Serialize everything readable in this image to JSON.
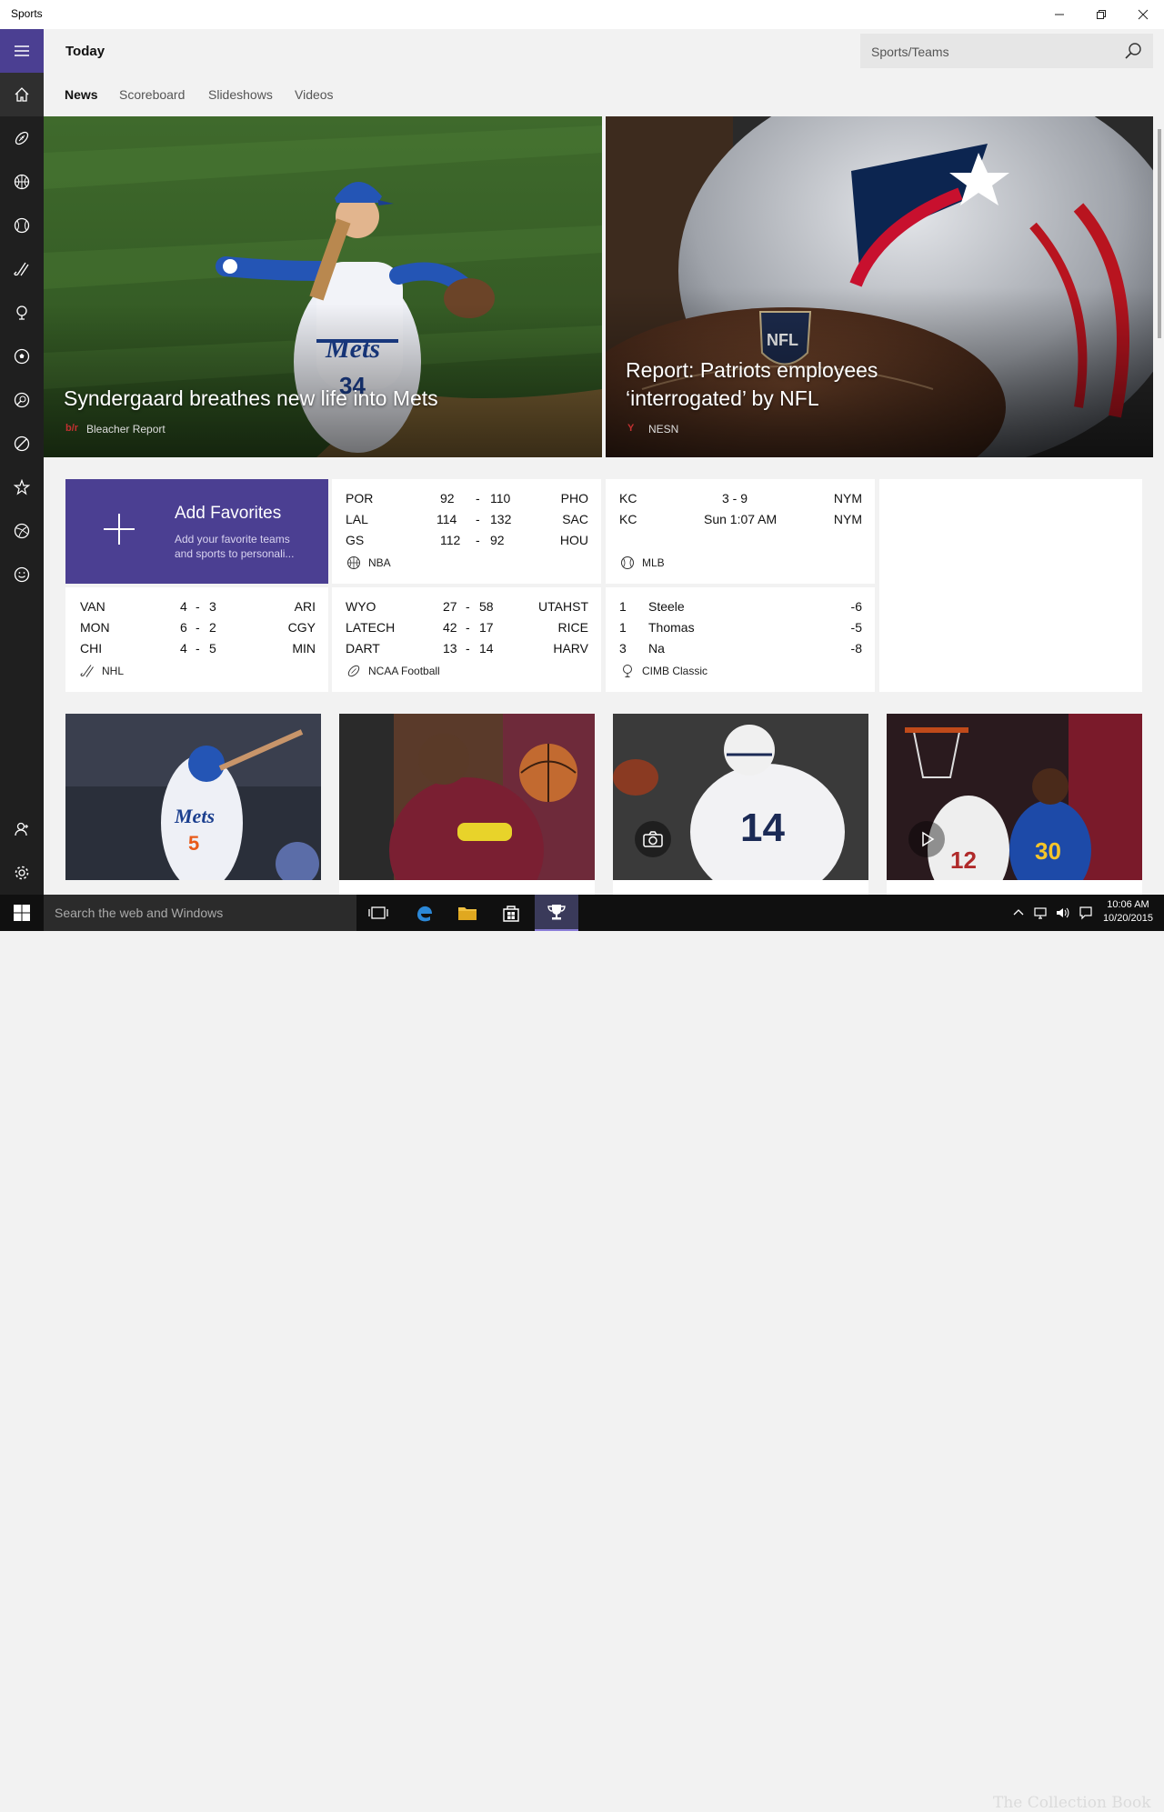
{
  "window": {
    "title": "Sports"
  },
  "header": {
    "page_title": "Today",
    "search_placeholder": "Sports/Teams"
  },
  "tabs": [
    {
      "label": "News"
    },
    {
      "label": "Scoreboard"
    },
    {
      "label": "Slideshows"
    },
    {
      "label": "Videos"
    }
  ],
  "heroes": [
    {
      "headline": "Syndergaard breathes new life into Mets",
      "source": "Bleacher Report",
      "source_logo": "b/r"
    },
    {
      "headline": "Report: Patriots employees ‘interrogated’ by NFL",
      "source": "NESN",
      "source_logo": "Y"
    }
  ],
  "favorites": {
    "title": "Add Favorites",
    "subtitle": "Add your favorite teams and sports to personali..."
  },
  "scores": {
    "nba": {
      "league": "NBA",
      "rows": [
        {
          "home": "POR",
          "s1": "92",
          "s2": "110",
          "away": "PHO"
        },
        {
          "home": "LAL",
          "s1": "114",
          "s2": "132",
          "away": "SAC"
        },
        {
          "home": "GS",
          "s1": "112",
          "s2": "92",
          "away": "HOU"
        }
      ]
    },
    "mlb": {
      "league": "MLB",
      "rows": [
        {
          "home": "KC",
          "status": "3 - 9",
          "away": "NYM"
        },
        {
          "home": "KC",
          "status": "Sun 1:07 AM",
          "away": "NYM"
        }
      ]
    },
    "nhl": {
      "league": "NHL",
      "rows": [
        {
          "home": "VAN",
          "s1": "4",
          "s2": "3",
          "away": "ARI"
        },
        {
          "home": "MON",
          "s1": "6",
          "s2": "2",
          "away": "CGY"
        },
        {
          "home": "CHI",
          "s1": "4",
          "s2": "5",
          "away": "MIN"
        }
      ]
    },
    "ncaa": {
      "league": "NCAA Football",
      "rows": [
        {
          "home": "WYO",
          "s1": "27",
          "s2": "58",
          "away": "UTAHST"
        },
        {
          "home": "LATECH",
          "s1": "42",
          "s2": "17",
          "away": "RICE"
        },
        {
          "home": "DART",
          "s1": "13",
          "s2": "14",
          "away": "HARV"
        }
      ]
    },
    "golf": {
      "league": "CIMB Classic",
      "rows": [
        {
          "pos": "1",
          "name": "Steele",
          "score": "-6"
        },
        {
          "pos": "1",
          "name": "Thomas",
          "score": "-5"
        },
        {
          "pos": "3",
          "name": "Na",
          "score": "-8"
        }
      ]
    }
  },
  "sep": "-",
  "taskbar": {
    "search": "Search the web and Windows",
    "time": "10:06 AM",
    "date": "10/20/2015"
  },
  "watermark": "The Collection Book",
  "colors": {
    "accent": "#4b3f92",
    "rail": "#1f1f1f",
    "taskbar": "#101010"
  },
  "icons": {
    "rail": [
      "hamburger-icon",
      "home-icon",
      "football-icon",
      "basketball-icon",
      "baseball-icon",
      "hockey-icon",
      "golf-icon",
      "soccer-icon",
      "tennis-icon",
      "cricket-icon",
      "favorite-star-icon",
      "rugby-icon",
      "smiley-icon",
      "account-icon",
      "settings-icon"
    ]
  }
}
